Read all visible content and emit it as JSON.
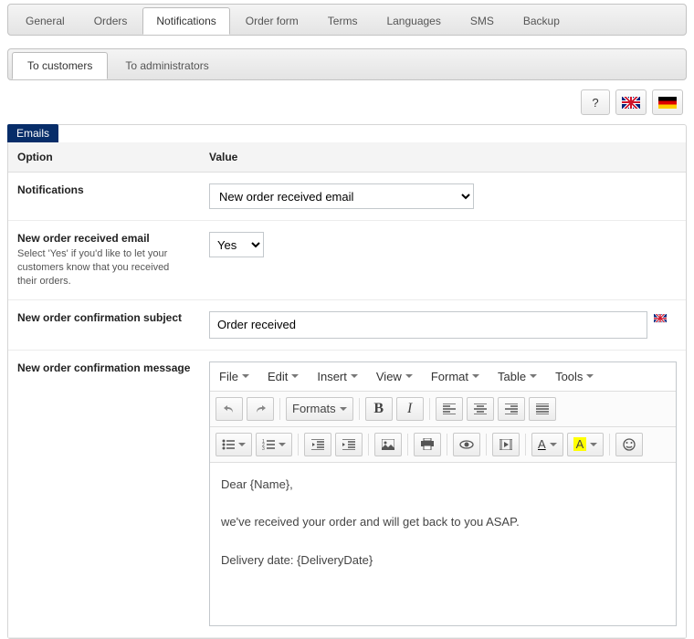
{
  "tabs": {
    "items": [
      {
        "label": "General"
      },
      {
        "label": "Orders"
      },
      {
        "label": "Notifications"
      },
      {
        "label": "Order form"
      },
      {
        "label": "Terms"
      },
      {
        "label": "Languages"
      },
      {
        "label": "SMS"
      },
      {
        "label": "Backup"
      }
    ],
    "activeIndex": 2
  },
  "subtabs": {
    "items": [
      {
        "label": "To customers"
      },
      {
        "label": "To administrators"
      }
    ],
    "activeIndex": 0
  },
  "help": {
    "label": "?"
  },
  "panel": {
    "title": "Emails"
  },
  "table": {
    "headers": {
      "option": "Option",
      "value": "Value"
    }
  },
  "rows": {
    "notifications": {
      "label": "Notifications",
      "value": "New order received email"
    },
    "enable": {
      "label": "New order received email",
      "desc": "Select 'Yes' if you'd like to let your customers know that you received their orders.",
      "value": "Yes"
    },
    "subject": {
      "label": "New order confirmation subject",
      "value": "Order received"
    },
    "message": {
      "label": "New order confirmation message"
    }
  },
  "editor": {
    "menu": {
      "file": "File",
      "edit": "Edit",
      "insert": "Insert",
      "view": "View",
      "format": "Format",
      "table": "Table",
      "tools": "Tools"
    },
    "toolbar": {
      "formats": "Formats",
      "a": "A"
    },
    "body": {
      "l1": "Dear {Name},",
      "l2": "we've received your order and will get back to you ASAP.",
      "l3": "Delivery date: {DeliveryDate}"
    }
  }
}
